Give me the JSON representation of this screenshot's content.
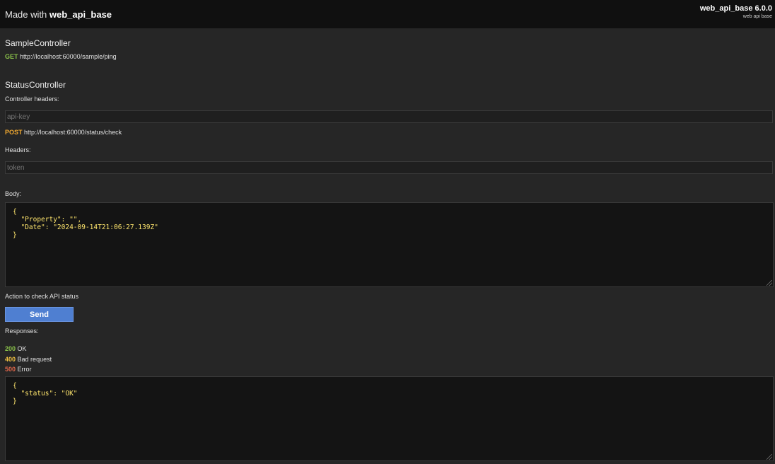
{
  "header": {
    "made_with_prefix": "Made with ",
    "made_with_name": "web_api_base",
    "version_title": "web_api_base 6.0.0",
    "version_subtitle": "web api base"
  },
  "sample_controller": {
    "title": "SampleController",
    "method": "GET",
    "url": "http://localhost:60000/sample/ping"
  },
  "status_controller": {
    "title": "StatusController",
    "controller_headers_label": "Controller headers:",
    "api_key_placeholder": "api-key",
    "method": "POST",
    "url": "http://localhost:60000/status/check",
    "headers_label": "Headers:",
    "token_placeholder": "token",
    "body_label": "Body:",
    "body_value": "{\n  \"Property\": \"\",\n  \"Date\": \"2024-09-14T21:06:27.139Z\"\n}",
    "description": "Action to check API status",
    "send_label": "Send",
    "responses_label": "Responses:",
    "responses": [
      {
        "code": "200",
        "text": "OK"
      },
      {
        "code": "400",
        "text": "Bad request"
      },
      {
        "code": "500",
        "text": "Error"
      }
    ],
    "response_value": "{\n  \"status\": \"OK\"\n}"
  }
}
